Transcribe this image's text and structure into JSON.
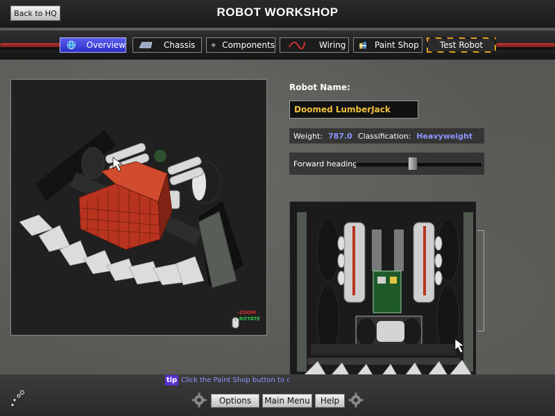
{
  "header": {
    "back_label": "Back to HQ",
    "title": "ROBOT WORKSHOP"
  },
  "tabs": [
    {
      "label": "Overview",
      "icon": "globe-icon",
      "active": true
    },
    {
      "label": "Chassis",
      "icon": "chassis-icon",
      "active": false
    },
    {
      "label": "Components",
      "icon": "gear-icon",
      "active": false
    },
    {
      "label": "Wiring",
      "icon": "wire-icon",
      "active": false
    },
    {
      "label": "Paint Shop",
      "icon": "paint-can-icon",
      "active": false
    },
    {
      "label": "Test Robot",
      "icon": "",
      "active": false
    }
  ],
  "viewport": {
    "zoom_label": "-ZOOM",
    "rotate_label": "-ROTATE"
  },
  "robot": {
    "name_label": "Robot Name:",
    "name_value": "Doomed LumberJack",
    "weight_label": "Weight:",
    "weight_value": "787.0",
    "class_label": "Classification:",
    "class_value": "Heavyweight",
    "heading_label": "Forward heading:",
    "heading_level": 0.45
  },
  "tip": {
    "badge": "tip",
    "text": "Click the Paint Shop button to cust"
  },
  "footer": {
    "options_label": "Options",
    "main_menu_label": "Main Menu",
    "help_label": "Help"
  },
  "colors": {
    "accent": "#8f95ff",
    "name_text": "#f0c040",
    "active_tab": "#3b3fd8",
    "armor_red": "#b8341f"
  }
}
